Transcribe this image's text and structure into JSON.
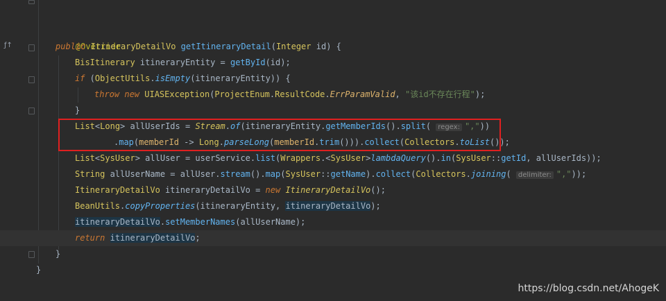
{
  "editor": {
    "lines": {
      "annotation": "@Override",
      "l2": {
        "public": "public",
        "ret_type": "ItineraryDetailVo",
        "method": "getItineraryDetail",
        "open": "(",
        "ptype": "Integer",
        "pname": " id",
        "close": ") {"
      },
      "l3": {
        "type": "BisItinerary",
        "var": " itineraryEntity = ",
        "call": "getById",
        "args": "(id);"
      },
      "l4": {
        "if": "if",
        "open": " (",
        "cls": "ObjectUtils",
        "dot": ".",
        "m": "isEmpty",
        "rest": "(itineraryEntity)) {"
      },
      "l5": {
        "throw": "throw",
        "new": " new",
        "cls": " UIASException",
        "open": "(",
        "pe": "ProjectEnum",
        "dot1": ".",
        "rc": "ResultCode",
        "dot2": ".",
        "err": "ErrParamValid",
        "comma": ", ",
        "str": "\"该id不存在行程\"",
        "end": ");"
      },
      "l6": "}",
      "l7": {
        "t1": "List",
        "lt": "<",
        "t2": "Long",
        "gt": ">",
        "var": " allUserIds = ",
        "cls": "Stream",
        "dot": ".",
        "of": "of",
        "open": "(itineraryEntity.",
        "gm": "getMemberIds",
        "mid": "().",
        "split": "split",
        "p": "( ",
        "hint": "regex:",
        "str": "\",\"",
        "end": "))"
      },
      "l8": {
        "dot": ".",
        "map": "map",
        "open": "(",
        "param": "memberId",
        "arrow": " -> ",
        "long": "Long",
        "dot2": ".",
        "parse": "parseLong",
        "open2": "(",
        "param2": "memberId",
        "dot3": ".",
        "trim": "trim",
        "mid": "())).",
        "collect": "collect",
        "open3": "(",
        "collectors": "Collectors",
        "dot4": ".",
        "tolist": "toList",
        "end": "());"
      },
      "l9": {
        "t1": "List",
        "lt": "<",
        "t2": "SysUser",
        "gt": ">",
        "var": " allUser = userService.",
        "list": "list",
        "open": "(",
        "wr": "Wrappers",
        "dot": ".",
        "lt2": "<",
        "su": "SysUser",
        "gt2": ">",
        "lq": "lambdaQuery",
        "mid": "().",
        "in": "in",
        "open2": "(",
        "su2": "SysUser",
        "ref": "::",
        "getid": "getId",
        "end": ", allUserIds));"
      },
      "l10": {
        "t": "String",
        "var": " allUserName = allUser.",
        "stream": "stream",
        "m1": "().",
        "map": "map",
        "open": "(",
        "su": "SysUser",
        "ref": "::",
        "gn": "getName",
        "m2": ").",
        "collect": "collect",
        "open2": "(",
        "collectors": "Collectors",
        "dot": ".",
        "joining": "joining",
        "p": "( ",
        "hint": "delimiter:",
        "str": "\",\"",
        "end": "));"
      },
      "l11": {
        "t": "ItineraryDetailVo",
        "var": " itineraryDetailVo = ",
        "new": "new",
        "cls": " ItineraryDetailVo",
        "end": "();"
      },
      "l12": {
        "cls": "BeanUtils",
        "dot": ".",
        "m": "copyProperties",
        "open": "(itineraryEntity, ",
        "hv": "itineraryDetailVo",
        "end": ");"
      },
      "l13": {
        "hv": "itineraryDetailVo",
        "dot": ".",
        "m": "setMemberNames",
        "end": "(allUserName);"
      },
      "l14": {
        "ret": "return",
        "sp": " ",
        "hv": "itineraryDetailVo",
        "end": ";"
      },
      "l15": "}",
      "l16": "}"
    },
    "gutter_icon": "override-icon"
  },
  "watermark": "https://blog.csdn.net/AhogeK",
  "colors": {
    "background": "#2b2b2b",
    "keyword": "#cc7832",
    "highlight_box": "#e02020"
  }
}
